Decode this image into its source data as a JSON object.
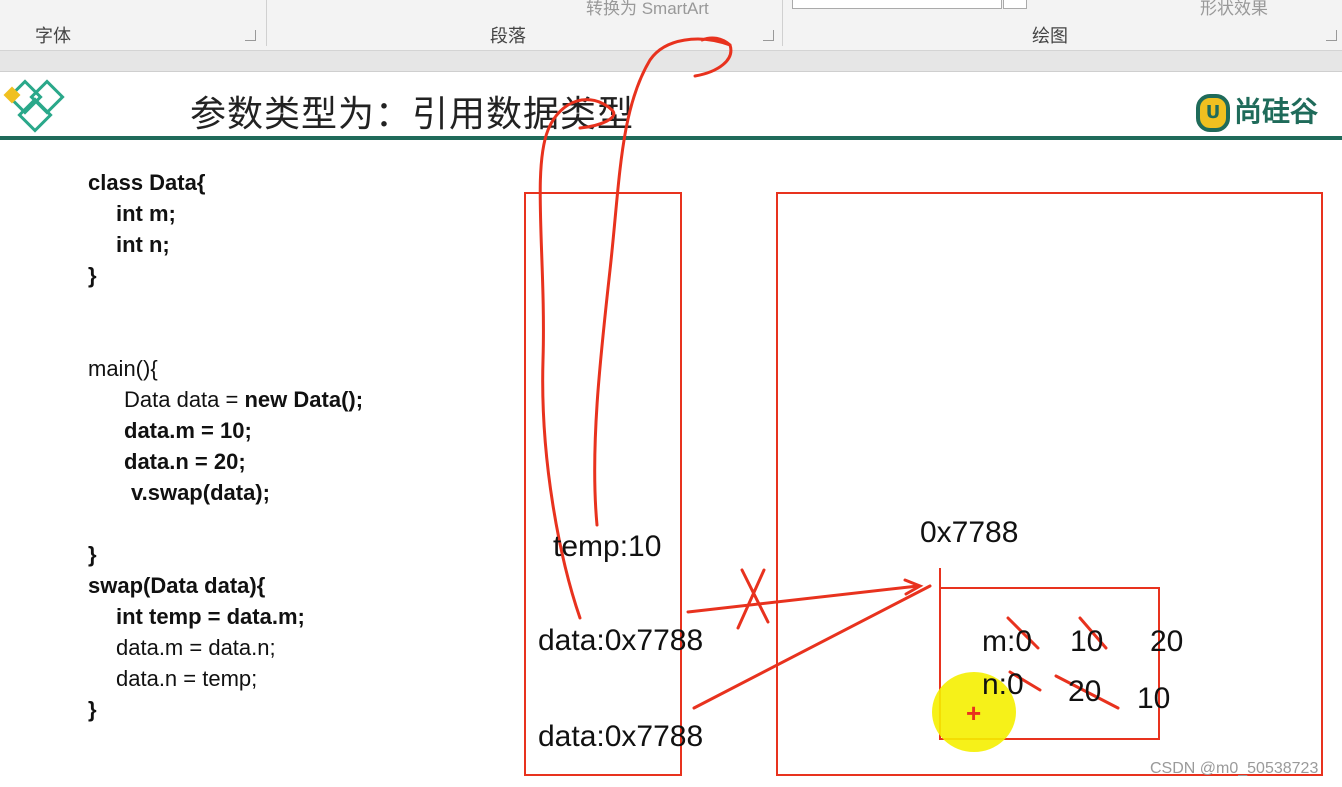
{
  "ribbon": {
    "group_font": "字体",
    "group_paragraph": "段落",
    "group_drawing": "绘图",
    "faded_smartart": "转换为 SmartArt",
    "faded_right": "形状效果"
  },
  "slide": {
    "title": "参数类型为：引用数据类型",
    "brand": "尚硅谷",
    "brand_mark": "U"
  },
  "code": {
    "lines": [
      "class Data{",
      "int m;",
      "int n;",
      "}",
      "main(){",
      "Data data = ",
      "new Data();",
      "data.m = 10;",
      "data.n = 20;",
      "v.swap(data);",
      "}",
      "swap(Data data){",
      "int temp = data.m;",
      "data.m = data.n;",
      "data.n = temp;",
      "}"
    ]
  },
  "stack": {
    "temp": "temp:10",
    "data1": "data:0x7788",
    "data2": "data:0x7788"
  },
  "heap": {
    "address": "0x7788",
    "m_label": "m:0",
    "m_v1": "10",
    "m_v2": "20",
    "n_label": "n:0",
    "n_v1": "20",
    "n_v2": "10",
    "cursor": "+"
  },
  "watermark": "CSDN @m0_50538723",
  "colors": {
    "annotation_red": "#e8321e",
    "highlight_yellow": "#f5f000",
    "title_rule_green": "#1f6b5a"
  }
}
